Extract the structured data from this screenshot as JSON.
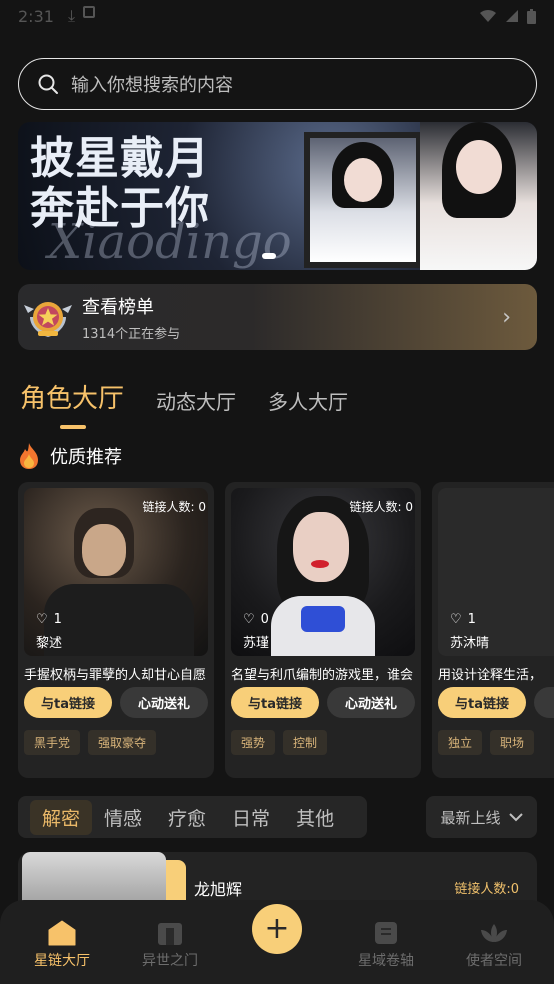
{
  "status_bar": {
    "time": "2:31"
  },
  "search": {
    "placeholder": "输入你想搜索的内容"
  },
  "banner": {
    "title_line1": "披星戴月",
    "title_line2": "奔赴于你",
    "script_text": "Xiaodingo"
  },
  "leaderboard": {
    "title": "查看榜单",
    "subtitle": "1314个正在参与"
  },
  "tabs": [
    {
      "label": "角色大厅",
      "active": true
    },
    {
      "label": "动态大厅",
      "active": false
    },
    {
      "label": "多人大厅",
      "active": false
    }
  ],
  "section": {
    "title": "优质推荐"
  },
  "cards": [
    {
      "link_count": "链接人数: 0",
      "likes": "1",
      "name": "黎述",
      "desc": "手握权柄与罪孽的人却甘心自愿",
      "btn_link": "与ta链接",
      "btn_gift": "心动送礼",
      "tags": [
        "黑手党",
        "强取豪夺"
      ]
    },
    {
      "link_count": "链接人数: 0",
      "likes": "0",
      "name": "苏瑾",
      "desc": "名望与利爪编制的游戏里，谁会",
      "btn_link": "与ta链接",
      "btn_gift": "心动送礼",
      "tags": [
        "强势",
        "控制"
      ]
    },
    {
      "link_count": "",
      "likes": "1",
      "name": "苏沐晴",
      "desc": "用设计诠释生活，",
      "btn_link": "与ta链接",
      "btn_gift": "",
      "tags": [
        "独立",
        "职场"
      ]
    }
  ],
  "filters": [
    {
      "label": "解密",
      "active": true
    },
    {
      "label": "情感",
      "active": false
    },
    {
      "label": "疗愈",
      "active": false
    },
    {
      "label": "日常",
      "active": false
    },
    {
      "label": "其他",
      "active": false
    }
  ],
  "sort": {
    "label": "最新上线"
  },
  "list_item": {
    "name": "龙旭辉",
    "link_count": "链接人数:0"
  },
  "bottom_nav": [
    {
      "label": "星链大厅",
      "icon": "home-icon",
      "active": true
    },
    {
      "label": "异世之门",
      "icon": "gate-icon",
      "active": false
    },
    {
      "label": "星域卷轴",
      "icon": "scroll-icon",
      "active": false
    },
    {
      "label": "使者空间",
      "icon": "lotus-icon",
      "active": false
    }
  ],
  "fab": {
    "symbol": "+"
  },
  "colors": {
    "accent": "#f7c26a",
    "button_gold": "#f8cf79",
    "background": "#141414"
  }
}
